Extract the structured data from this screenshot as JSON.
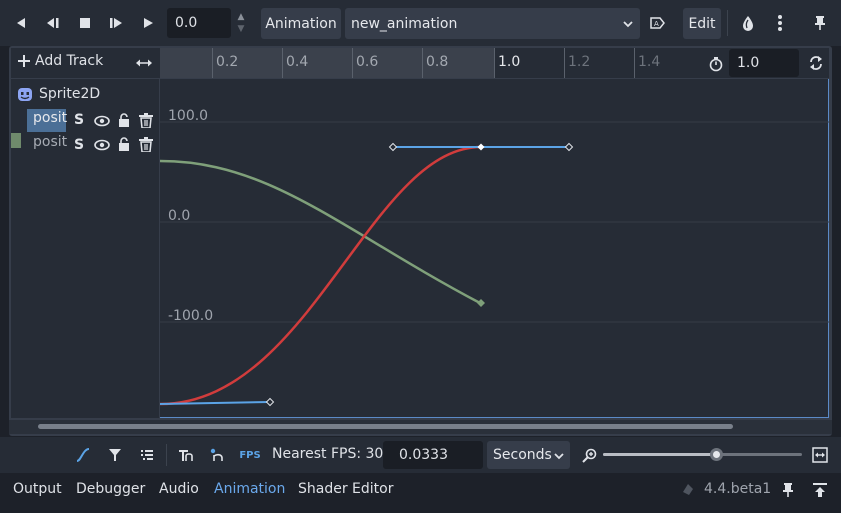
{
  "toolbar": {
    "time_value": "0.0",
    "animation_label": "Animation",
    "animation_name": "new_animation",
    "edit_label": "Edit"
  },
  "timeline": {
    "add_track_label": "Add Track",
    "ticks": [
      "0.2",
      "0.4",
      "0.6",
      "0.8",
      "1.0",
      "1.2",
      "1.4"
    ],
    "length_value": "1.0"
  },
  "tracks": {
    "node_name": "Sprite2D",
    "track_1": "posit",
    "track_2": "posit"
  },
  "graph": {
    "y_labels": [
      "100.0",
      "0.0",
      "-100.0"
    ],
    "colors": {
      "red": "#d13c3c",
      "green": "#7fa07a",
      "blue": "#5ba3e6"
    }
  },
  "bottombar": {
    "fps_label": "Nearest FPS: 30",
    "snap_value": "0.0333",
    "unit_select": "Seconds"
  },
  "tabs": {
    "output": "Output",
    "debugger": "Debugger",
    "audio": "Audio",
    "animation": "Animation",
    "shader_editor": "Shader Editor",
    "version": "4.4.beta1"
  }
}
